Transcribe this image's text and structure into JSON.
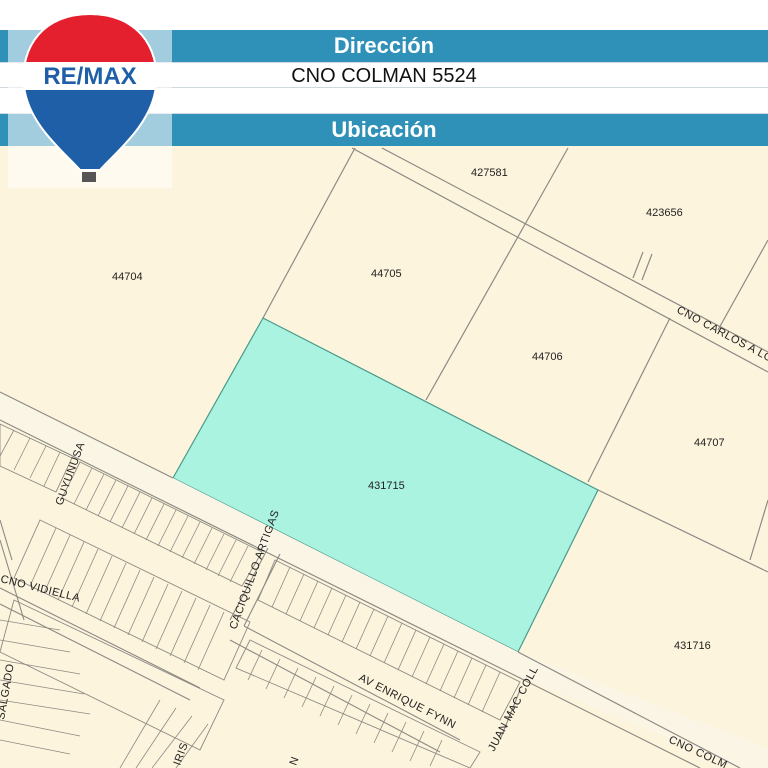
{
  "header": {
    "direccion_label": "Dirección",
    "address_value": "CNO COLMAN 5524",
    "ubicacion_label": "Ubicación"
  },
  "logo": {
    "brand_text": "RE/MAX",
    "colors": {
      "red": "#e5202e",
      "blue": "#1f5fa8",
      "white": "#ffffff"
    }
  },
  "map": {
    "colors": {
      "background": "#fdf4dd",
      "highlight_parcel": "#a9f3e0",
      "parcel_line": "#8c8a84",
      "street_fill": "#fbf5e6"
    },
    "parcels": {
      "p427581": "427581",
      "p423656": "423656",
      "p44704": "44704",
      "p44705": "44705",
      "p44706": "44706",
      "p44707": "44707",
      "p431715": "431715",
      "p431716": "431716"
    },
    "streets": {
      "carlos": "CNO CARLOS A LO",
      "guyunusa": "GUYUNUSA",
      "caciquillo": "CACIQUILLO ARTIGAS",
      "vidiella": "CNO VIDIELLA",
      "enrique_fynn": "AV ENRIQUE FYNN",
      "juan_mac_coll": "JUAN MAC COLL",
      "colman": "CNO COLM",
      "iris": "IRIS",
      "salgado": "SALGADO",
      "n": "N"
    }
  }
}
